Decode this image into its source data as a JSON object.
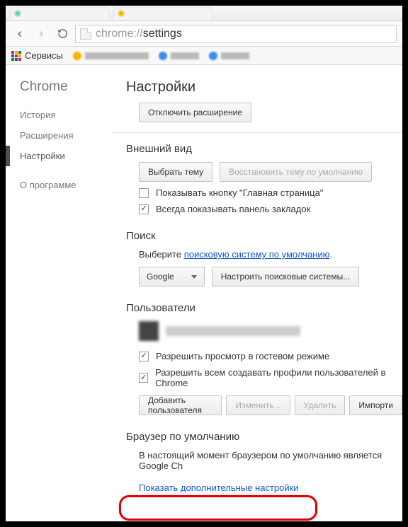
{
  "omnibox": {
    "scheme": "chrome://",
    "path": "settings"
  },
  "bookmarks": {
    "apps_label": "Сервисы"
  },
  "sidebar": {
    "brand": "Chrome",
    "items": [
      {
        "label": "История"
      },
      {
        "label": "Расширения"
      },
      {
        "label": "Настройки"
      },
      {
        "label": "О программе"
      }
    ]
  },
  "page": {
    "title": "Настройки"
  },
  "extensions": {
    "disable_btn": "Отключить расширение"
  },
  "appearance": {
    "title": "Внешний вид",
    "choose_theme_btn": "Выбрать тему",
    "restore_theme_btn": "Восстановить тему по умолчанию",
    "show_home_label": "Показывать кнопку \"Главная страница\"",
    "show_home_checked": false,
    "show_bookbar_label": "Всегда показывать панель закладок",
    "show_bookbar_checked": true
  },
  "search": {
    "title": "Поиск",
    "desc_prefix": "Выберите ",
    "desc_link": "поисковую систему по умолчанию",
    "desc_suffix": ".",
    "selected_engine": "Google",
    "manage_btn": "Настроить поисковые системы..."
  },
  "users": {
    "title": "Пользователи",
    "guest_label": "Разрешить просмотр в гостевом режиме",
    "guest_checked": true,
    "create_profiles_label": "Разрешить всем создавать профили пользователей в Chrome",
    "create_profiles_checked": true,
    "add_btn": "Добавить пользователя",
    "edit_btn": "Изменить...",
    "delete_btn": "Удалить",
    "import_btn": "Импорти"
  },
  "default_browser": {
    "title": "Браузер по умолчанию",
    "status": "В настоящий момент браузером по умолчанию является Google Ch"
  },
  "show_more": {
    "label": "Показать дополнительные настройки"
  }
}
